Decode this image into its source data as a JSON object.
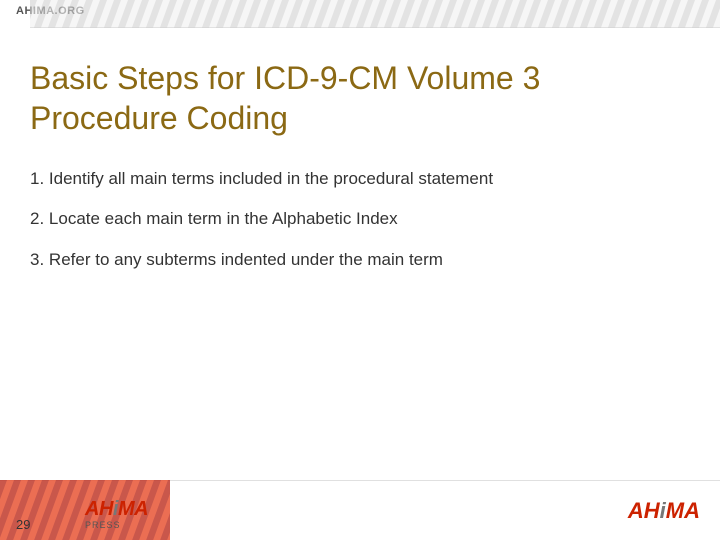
{
  "header": {
    "org_label": "AHIMA.ORG"
  },
  "slide": {
    "title_line1": "Basic Steps for ICD-9-CM Volume 3",
    "title_line2": "Procedure Coding",
    "steps": [
      {
        "number": "1.",
        "text": "Identify all main terms included in the procedural statement"
      },
      {
        "number": "2.",
        "text": "Locate each main term in the Alphabetic Index"
      },
      {
        "number": "3.",
        "text": "Refer to any subterms indented under the main term"
      }
    ]
  },
  "footer": {
    "page_number": "29",
    "left_logo_main": "AHiMA",
    "left_logo_sub": "PRESS",
    "right_logo": "AHiMA"
  },
  "colors": {
    "title": "#8B6914",
    "red": "#cc2200",
    "stripe_dark": "#c0392b",
    "stripe_light": "#e8e8e8",
    "text": "#333333"
  }
}
